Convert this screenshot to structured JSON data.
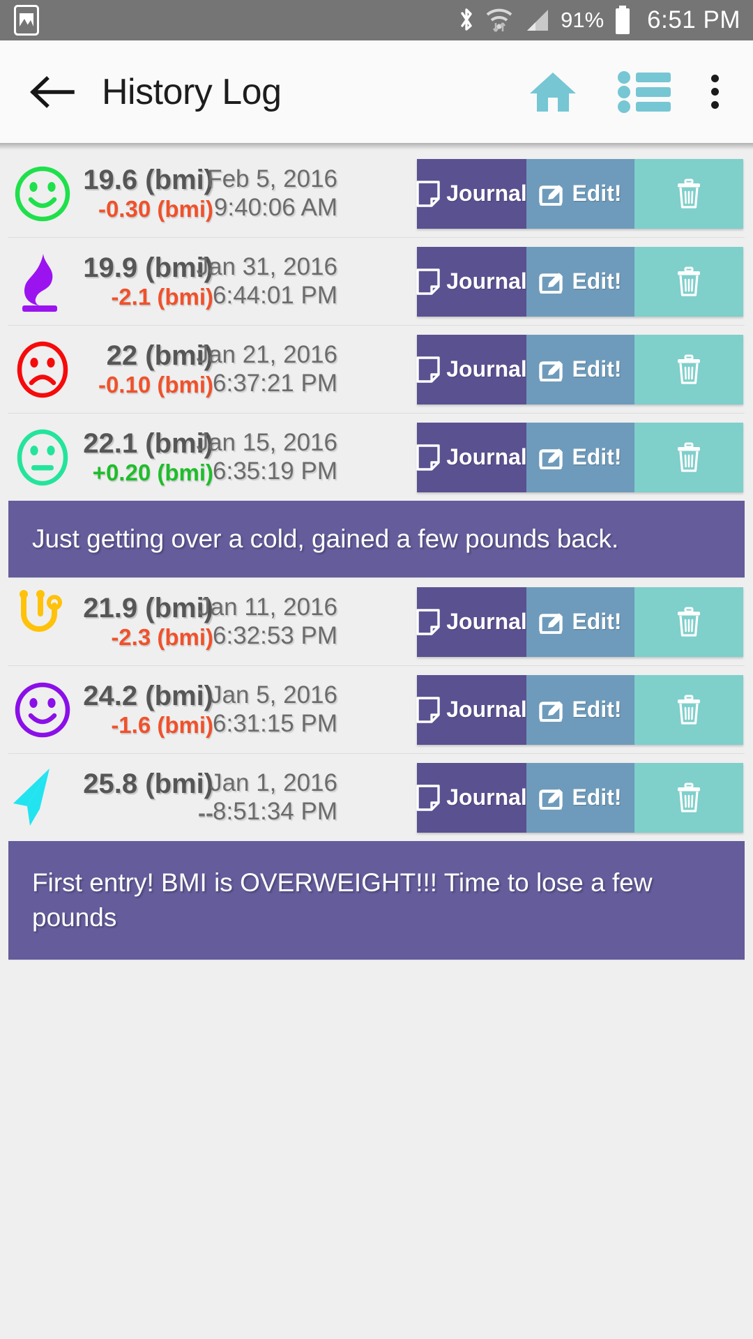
{
  "statusbar": {
    "battery_percent": "91%",
    "time": "6:51 PM",
    "icons": [
      "gallery-icon",
      "bluetooth-icon",
      "wifi-icon",
      "signal-icon",
      "battery-icon"
    ]
  },
  "appbar": {
    "title": "History Log",
    "back_label": "back-arrow-icon",
    "home_label": "home-icon",
    "list_label": "list-icon",
    "overflow_label": "overflow-menu-icon",
    "accent_color": "#76C6D4"
  },
  "buttons": {
    "journal": "Journal",
    "edit": "Edit!",
    "delete": "delete-icon",
    "journal_color": "#5A5191",
    "edit_color": "#6E9BBB",
    "delete_color": "#7FCFCB"
  },
  "colors": {
    "negative": "#F0512B",
    "positive": "#1FBD2B",
    "note_bg": "#645C9B",
    "page_bg": "#EFEFEF"
  },
  "entries": [
    {
      "icon": "smiley-happy-icon",
      "icon_color": "#1FE04B",
      "bmi": "19.6 (bmi)",
      "delta": "-0.30 (bmi)",
      "delta_sign": "neg",
      "date": "Feb 5, 2016",
      "time": "9:40:06 AM",
      "note": null
    },
    {
      "icon": "flame-icon",
      "icon_color": "#9B14F0",
      "bmi": "19.9 (bmi)",
      "delta": "-2.1 (bmi)",
      "delta_sign": "neg",
      "date": "Jan 31, 2016",
      "time": "6:44:01 PM",
      "note": null
    },
    {
      "icon": "smiley-sad-icon",
      "icon_color": "#F50B0B",
      "bmi": "22 (bmi)",
      "delta": "-0.10 (bmi)",
      "delta_sign": "neg",
      "date": "Jan 21, 2016",
      "time": "6:37:21 PM",
      "note": null
    },
    {
      "icon": "smiley-neutral-icon",
      "icon_color": "#24E49B",
      "bmi": "22.1 (bmi)",
      "delta": "+0.20 (bmi)",
      "delta_sign": "pos",
      "date": "Jan 15, 2016",
      "time": "6:35:19 PM",
      "note": "Just getting over a cold, gained a few pounds back."
    },
    {
      "icon": "stethoscope-icon",
      "icon_color": "#FFC20A",
      "bmi": "21.9 (bmi)",
      "delta": "-2.3 (bmi)",
      "delta_sign": "neg",
      "date": "Jan 11, 2016",
      "time": "6:32:53 PM",
      "note": null
    },
    {
      "icon": "smiley-happy-icon",
      "icon_color": "#8A0FE8",
      "bmi": "24.2 (bmi)",
      "delta": "-1.6 (bmi)",
      "delta_sign": "neg",
      "date": "Jan 5, 2016",
      "time": "6:31:15 PM",
      "note": null
    },
    {
      "icon": "paper-plane-icon",
      "icon_color": "#22E4F0",
      "bmi": "25.8 (bmi)",
      "delta": "--",
      "delta_sign": "none",
      "date": "Jan 1, 2016",
      "time": "8:51:34 PM",
      "note": "First entry! BMI is OVERWEIGHT!!!  Time to lose a few pounds"
    }
  ]
}
